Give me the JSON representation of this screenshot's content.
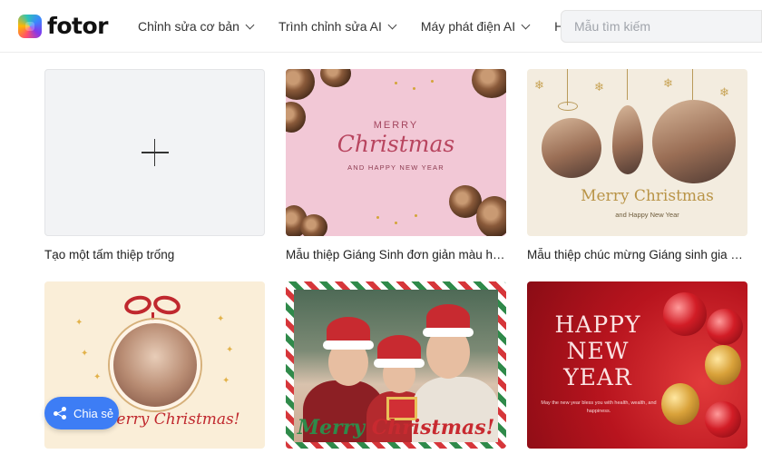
{
  "header": {
    "logo_text": "fotor",
    "nav": [
      {
        "label": "Chỉnh sửa cơ bản"
      },
      {
        "label": "Trình chỉnh sửa AI"
      },
      {
        "label": "Máy phát điện AI"
      },
      {
        "label": "Hơn"
      }
    ],
    "search": {
      "placeholder": "Mẫu tìm kiếm",
      "value": ""
    }
  },
  "templates": [
    {
      "caption": "Tạo một tấm thiệp trống"
    },
    {
      "caption": "Mẫu thiệp Giáng Sinh đơn giản màu hồng",
      "card_text": {
        "merry": "MERRY",
        "christmas": "Christmas",
        "sub": "AND HAPPY NEW YEAR"
      }
    },
    {
      "caption": "Mẫu thiệp chúc mừng Giáng sinh gia đìn...",
      "card_text": {
        "title": "Merry Christmas",
        "sub": "and Happy New Year"
      }
    },
    {
      "caption": "",
      "card_text": {
        "title": "Merry Christmas!"
      }
    },
    {
      "caption": "",
      "card_text": {
        "merry": "Merry",
        "christmas": "Christmas!"
      }
    },
    {
      "caption": "",
      "card_text": {
        "title_lines": [
          "HAPPY",
          "NEW",
          "YEAR"
        ],
        "sub": "May the new year bless you with health, wealth, and happiness."
      }
    }
  ],
  "share_button": {
    "label": "Chia sẻ"
  },
  "colors": {
    "accent": "#3d7df5",
    "card_red": "#b8141e",
    "card_pink": "#f2c8d6",
    "card_cream": "#f3ecdf"
  }
}
